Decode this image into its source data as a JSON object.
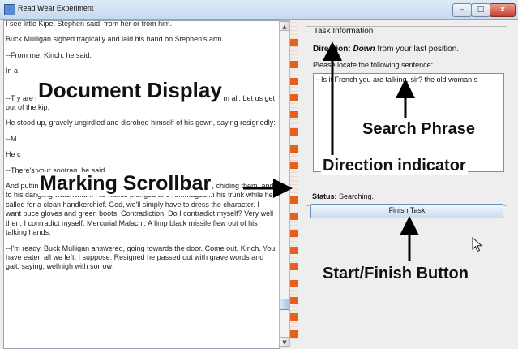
{
  "window": {
    "title": "Read Wear Experiment",
    "controls": {
      "minimize": "–",
      "maximize": "□",
      "close": "x"
    }
  },
  "document": {
    "paragraphs": [
      "I see little Kipe, Stephen said, from her or from him.",
      "Buck Mulligan sighed tragically and laid his hand on Stephen's arm.",
      "--From me, Kinch, he said.",
      "In a",
      "--T                                                                            y are good for. Why don't you play them as I do? To hell with them all. Let us get out of the kip.",
      "He stood up, gravely ungirdled and disrobed himself of his gown, saying resignedly:",
      "--M",
      "He c",
      "--There's your snotrag, he said.",
      "And putting on his stiff collar and rebellious tie he spoke to them, chiding them, and to his dangling watchchain. His hands plunged and rummaged in his trunk while he called for a clean handkerchief. God, we'll simply have to dress the character. I want puce gloves and green boots. Contradiction. Do I contradict myself? Very well then, I contradict myself. Mercurial Malachi. A limp black missile flew out of his talking hands.",
      "--I'm ready, Buck Mulligan answered, going towards the door. Come out, Kinch. You have eaten all we left, I suppose. Resigned he passed out with grave words and gait, saying, wellnigh with sorrow:"
    ]
  },
  "scrollbar": {
    "up_glyph": "▲",
    "down_glyph": "▼",
    "thumb_glyph": "≡"
  },
  "task": {
    "legend": "Task Information",
    "direction_label": "Direction:",
    "direction_value": "Down",
    "direction_suffix": "from your last position.",
    "locate_prompt": "Please locate the following sentence:",
    "search_phrase": "--Is it French you are talking, sir? the old woman s",
    "status_label": "Status:",
    "status_value": "Searching.",
    "finish_button": "Finish Task"
  },
  "annotations": {
    "document_display": "Document Display",
    "marking_scrollbar": "Marking Scrollbar",
    "search_phrase": "Search Phrase",
    "direction_indicator": "Direction indicator",
    "start_finish_button": "Start/Finish Button"
  },
  "colors": {
    "mark": "#e5601a",
    "accent": "#6d8fb8"
  }
}
